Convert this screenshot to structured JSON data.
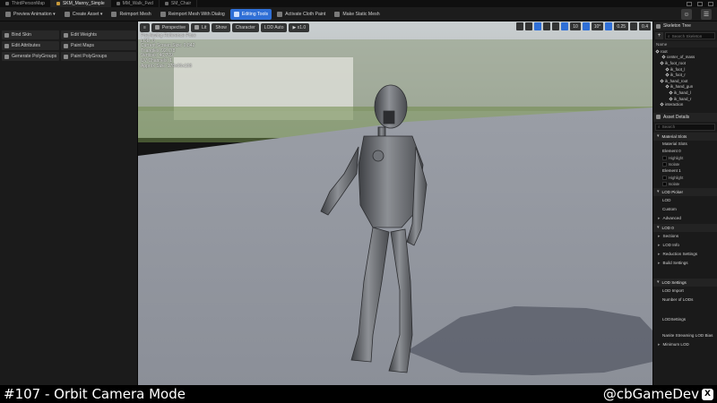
{
  "tabs": [
    {
      "label": "ThirdPersonMap",
      "active": false
    },
    {
      "label": "SKM_Manny_Simple",
      "active": true
    },
    {
      "label": "MM_Walk_Fwd",
      "active": false
    },
    {
      "label": "SM_Chair",
      "active": false
    }
  ],
  "toolbar": {
    "preview_animation": "Preview Animation ▾",
    "create_asset": "Create Asset ▾",
    "reimport_mesh": "Reimport Mesh",
    "reimport_mesh_dialog": "Reimport Mesh With Dialog",
    "editing_tools": "Editing Tools",
    "activate_cloth_paint": "Activate Cloth Paint",
    "make_static_mesh": "Make Static Mesh"
  },
  "tools": [
    "Bind Skin",
    "Edit Weights",
    "Edit Attributes",
    "Paint Maps",
    "Generate PolyGroups",
    "Paint PolyGroups"
  ],
  "viewport": {
    "menu_label": "≡",
    "perspective": "Perspective",
    "lit": "Lit",
    "show": "Show",
    "character": "Character",
    "lod_auto": "LOD Auto",
    "play_rate": "▶ x1.0",
    "grid_snap": "10",
    "rot_snap": "10°",
    "scale_snap": "0.25",
    "cam_speed": "0.4",
    "stats": [
      "Previewing Reference Pose",
      "LOD: 0",
      "Current Screen Size: 0.842",
      "Triangles: 92,778",
      "Vertices: 46,709",
      "UV Channels: 1",
      "Approx Size: 178x66x188"
    ]
  },
  "skeleton_tree": {
    "title": "Skeleton Tree",
    "add": "+",
    "search_placeholder": "Search Skeleton",
    "column_name": "Name",
    "items": [
      "root",
      "center_of_mass",
      "ik_foot_root",
      "ik_foot_l",
      "ik_foot_r",
      "ik_hand_root",
      "ik_hand_gun",
      "ik_hand_l",
      "ik_hand_r",
      "interaction"
    ]
  },
  "asset_details": {
    "title": "Asset Details",
    "search_placeholder": "Search",
    "material_slots_section": "Material Slots",
    "material_slots_label": "Material Slots",
    "element0": "Element 0",
    "element0_highlight": "Highlight",
    "element0_isolate": "Isolate",
    "element1": "Element 1",
    "element1_highlight": "Highlight",
    "element1_isolate": "Isolate",
    "lod_picker_section": "LOD Picker",
    "lod_label": "LOD",
    "custom_label": "Custom",
    "advanced_label": "Advanced",
    "lod0_section": "LOD 0",
    "sections_label": "Sections",
    "lod_info_label": "LOD Info",
    "reduction_settings_label": "Reduction Settings",
    "build_settings_label": "Build Settings",
    "lod_settings_section": "LOD Settings",
    "lod_import_label": "LOD Import",
    "num_lods_label": "Number of LODs",
    "lod_settings_label": "LODSettings",
    "nanite_streaming_label": "Nanite Streaming LOD Bias",
    "minimum_lod_label": "Minimum LOD"
  },
  "caption": {
    "left": "#107 - Orbit Camera Mode",
    "right": "@cbGameDev",
    "logo": "X"
  }
}
